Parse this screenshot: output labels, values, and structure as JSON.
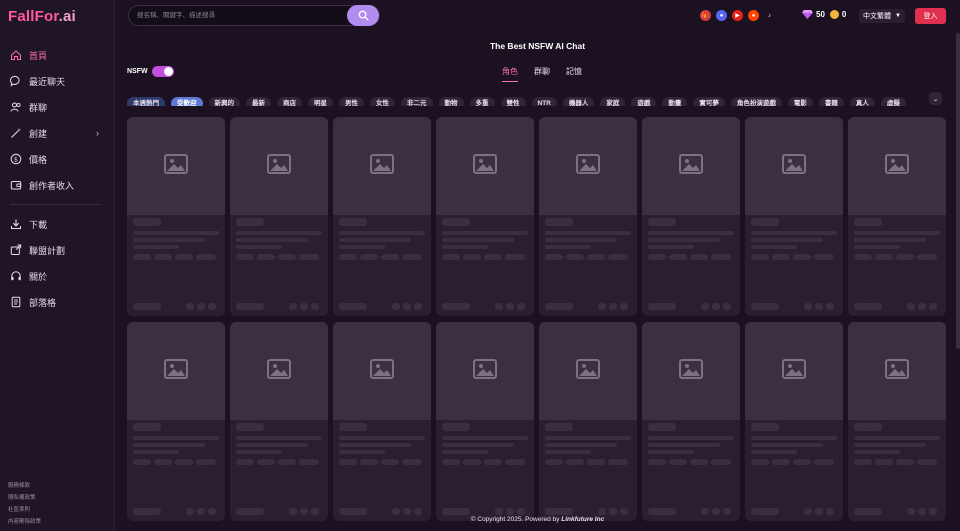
{
  "app": {
    "logo_main": "FallFor",
    "logo_suffix": ".ai"
  },
  "sidebar": {
    "items": [
      {
        "label": "首頁",
        "icon": "home-icon",
        "active": true
      },
      {
        "label": "最近聊天",
        "icon": "chat-icon"
      },
      {
        "label": "群聊",
        "icon": "group-icon"
      },
      {
        "label": "創建",
        "icon": "magic-wand-icon",
        "has_chevron": true
      },
      {
        "label": "價格",
        "icon": "dollar-icon"
      },
      {
        "label": "創作者收入",
        "icon": "wallet-icon"
      },
      {
        "label": "下載",
        "icon": "download-icon"
      },
      {
        "label": "聯盟計劃",
        "icon": "share-icon"
      },
      {
        "label": "關於",
        "icon": "headset-icon"
      },
      {
        "label": "部落格",
        "icon": "document-icon"
      }
    ],
    "footer_links": [
      "服務條款",
      "隱私權政策",
      "社區準則",
      "內容刪除政策"
    ]
  },
  "header": {
    "search_placeholder": "搜名稱、關鍵字、描述搜尋",
    "gems": "50",
    "coins": "0",
    "language": "中文繁體",
    "login_label": "登入",
    "social": [
      {
        "name": "gift-icon",
        "color": "#d23a4a",
        "glyph": "🎁"
      },
      {
        "name": "discord-icon",
        "color": "#5865f2",
        "glyph": "●"
      },
      {
        "name": "youtube-icon",
        "color": "#e62117",
        "glyph": "▶"
      },
      {
        "name": "reddit-icon",
        "color": "#ff4500",
        "glyph": "●"
      },
      {
        "name": "tiktok-icon",
        "color": "#1b1120",
        "glyph": "♪"
      }
    ]
  },
  "main": {
    "title": "The Best NSFW AI Chat",
    "nsfw_label": "NSFW",
    "nsfw_on": true,
    "tabs": [
      {
        "label": "角色",
        "active": true
      },
      {
        "label": "群聊"
      },
      {
        "label": "記憶"
      }
    ],
    "tags": [
      "本週熱門",
      "受歡迎",
      "新興的",
      "最新",
      "商店",
      "明星",
      "男性",
      "女性",
      "非二元",
      "動物",
      "多重",
      "雙性",
      "NTR",
      "機器人",
      "家庭",
      "遊戲",
      "動畫",
      "實可夢",
      "角色扮演遊戲",
      "電影",
      "書籍",
      "真人",
      "虛擬"
    ],
    "selected_tag": "受歡迎"
  },
  "footer": {
    "copyright": "© Copyright 2025. Powered by",
    "company": "Linkfuture Inc"
  },
  "colors": {
    "accent": "#ff6fb0",
    "bg": "#1b1120",
    "card": "#2a1f2f",
    "login": "#e0304d",
    "tag_selected": "#5f78d6"
  }
}
